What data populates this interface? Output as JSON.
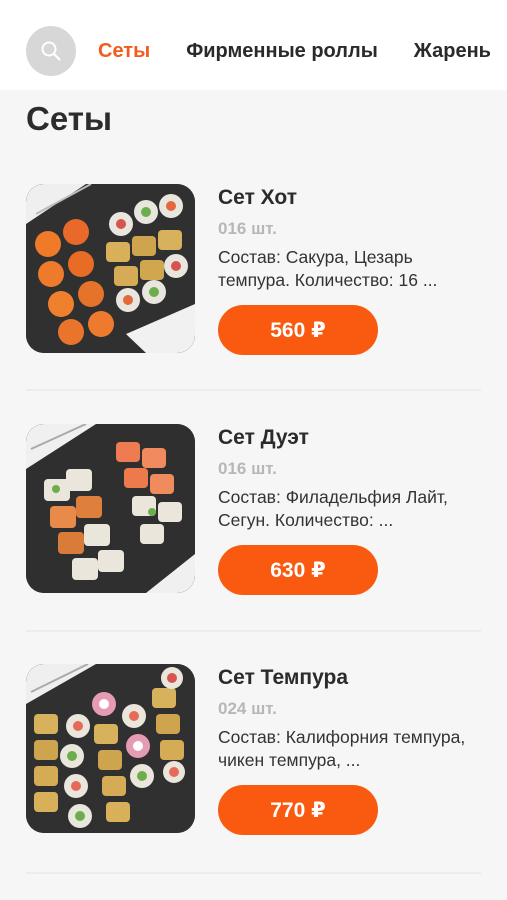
{
  "header": {
    "search_icon": "search-icon",
    "tabs": [
      {
        "label": "Сеты",
        "active": true
      },
      {
        "label": "Фирменные роллы",
        "active": false
      },
      {
        "label": "Жарень",
        "active": false
      }
    ]
  },
  "page": {
    "title": "Сеты"
  },
  "products": [
    {
      "name": "Сет Хот",
      "qty": "016 шт.",
      "description": "Состав: Сакура, Цезарь темпура.  Количество: 16 ...",
      "price": "560 ₽"
    },
    {
      "name": "Сет Дуэт",
      "qty": "016 шт.",
      "description": "Состав: Филадельфия Лайт, Сегун.  Количество: ...",
      "price": "630 ₽"
    },
    {
      "name": "Сет Темпура",
      "qty": "024 шт.",
      "description": "Состав: Калифорния темпура, чикен темпура, ...",
      "price": "770 ₽"
    }
  ],
  "colors": {
    "accent": "#f25c1c",
    "button": "#fa5a10",
    "qty_text": "#b7b7b7"
  }
}
